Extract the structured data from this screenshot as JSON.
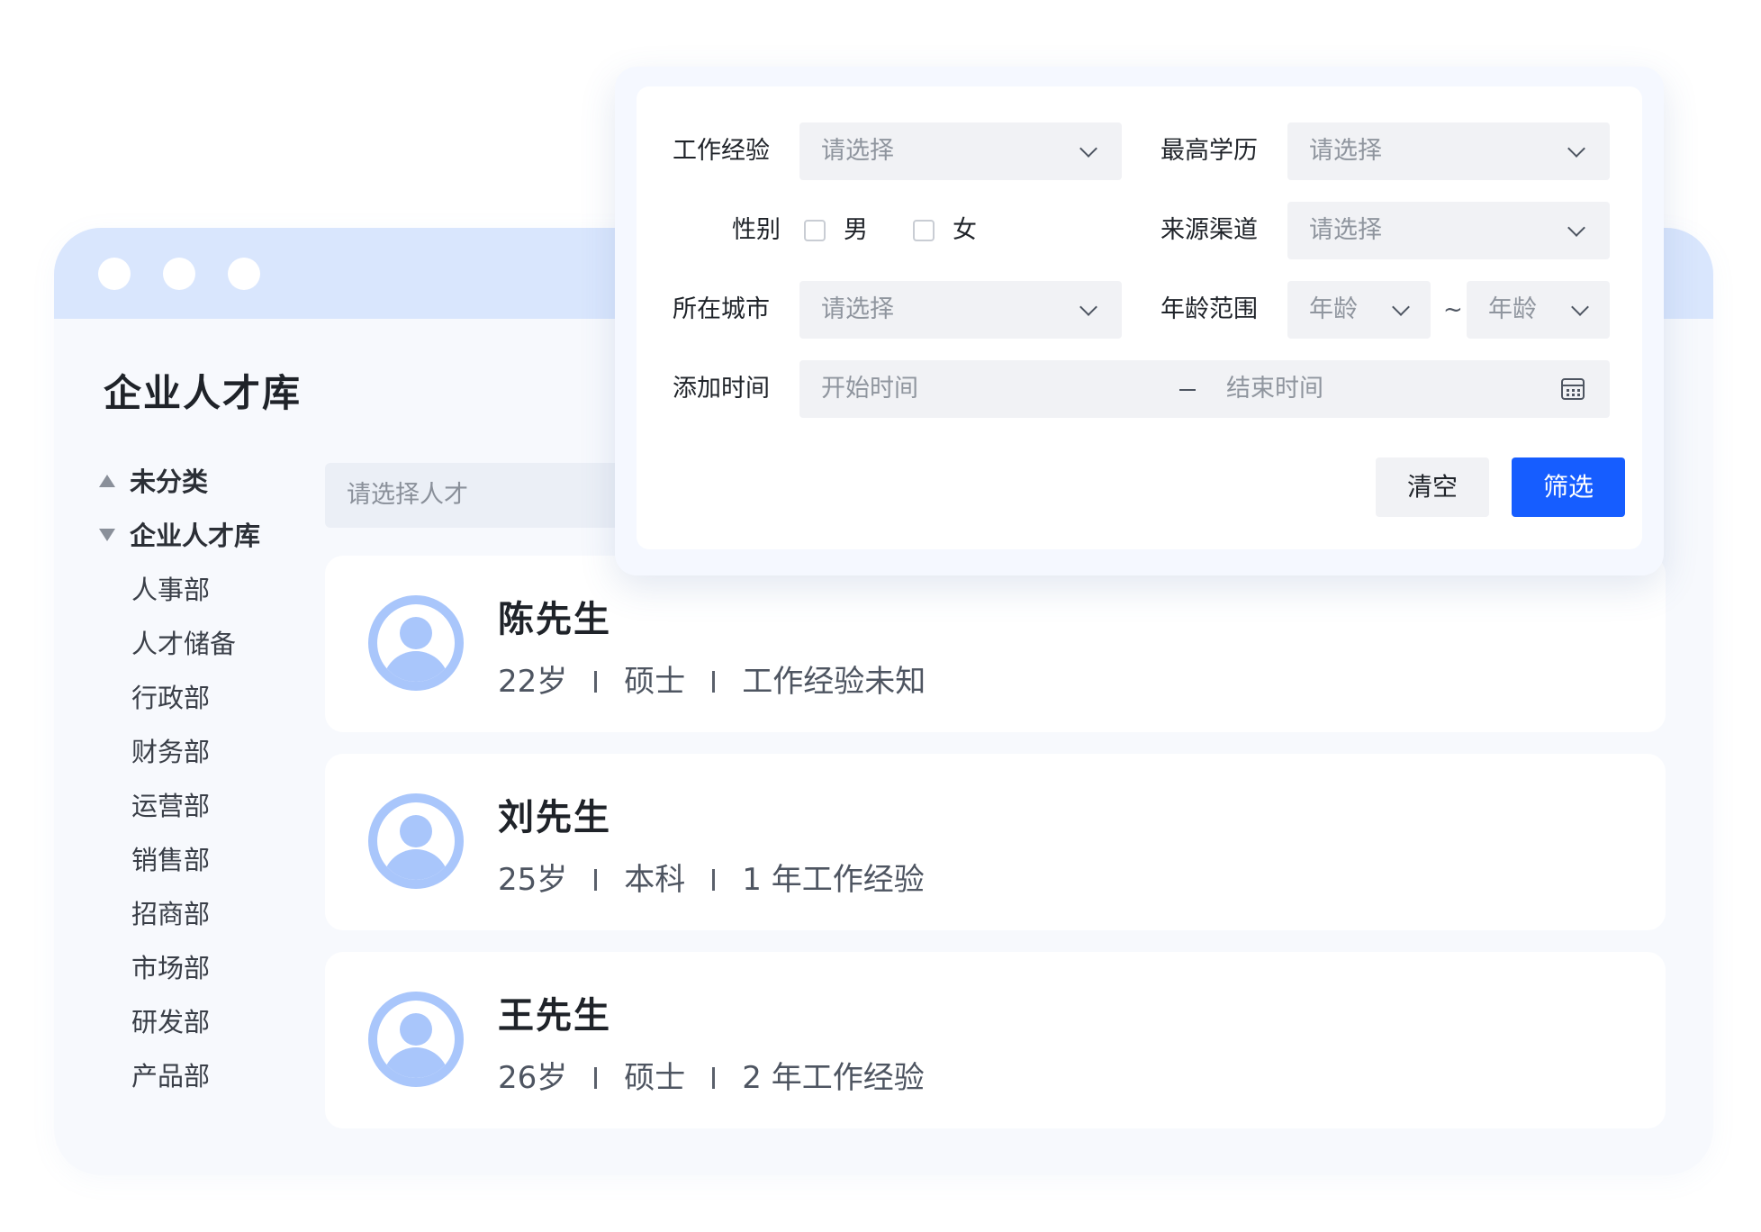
{
  "window": {
    "dots": [
      "dot",
      "dot",
      "dot"
    ],
    "title": "企业人才库"
  },
  "sidebar": {
    "groups": [
      {
        "label": "未分类",
        "expanded": false
      },
      {
        "label": "企业人才库",
        "expanded": true
      }
    ],
    "departments": [
      "人事部",
      "人才储备",
      "行政部",
      "财务部",
      "运营部",
      "销售部",
      "招商部",
      "市场部",
      "研发部",
      "产品部"
    ]
  },
  "search": {
    "placeholder": "请选择人才"
  },
  "candidates": [
    {
      "name": "陈先生",
      "age": "22岁",
      "education": "硕士",
      "experience": "工作经验未知"
    },
    {
      "name": "刘先生",
      "age": "25岁",
      "education": "本科",
      "experience": "1 年工作经验"
    },
    {
      "name": "王先生",
      "age": "26岁",
      "education": "硕士",
      "experience": "2 年工作经验"
    }
  ],
  "filter": {
    "work_experience": {
      "label": "工作经验",
      "placeholder": "请选择"
    },
    "education": {
      "label": "最高学历",
      "placeholder": "请选择"
    },
    "gender": {
      "label": "性别",
      "options": [
        "男",
        "女"
      ]
    },
    "source": {
      "label": "来源渠道",
      "placeholder": "请选择"
    },
    "city": {
      "label": "所在城市",
      "placeholder": "请选择"
    },
    "age_range": {
      "label": "年龄范围",
      "min_placeholder": "年龄",
      "max_placeholder": "年龄",
      "separator": "~"
    },
    "add_time": {
      "label": "添加时间",
      "start_placeholder": "开始时间",
      "end_placeholder": "结束时间"
    },
    "clear_label": "清空",
    "submit_label": "筛选"
  },
  "colors": {
    "accent": "#165dff",
    "titlebar": "#d9e6fd",
    "avatar": "#a9c6fb"
  },
  "icons": {
    "dropdown": "chevron-down-icon",
    "calendar": "calendar-icon",
    "avatar": "user-avatar-icon"
  }
}
